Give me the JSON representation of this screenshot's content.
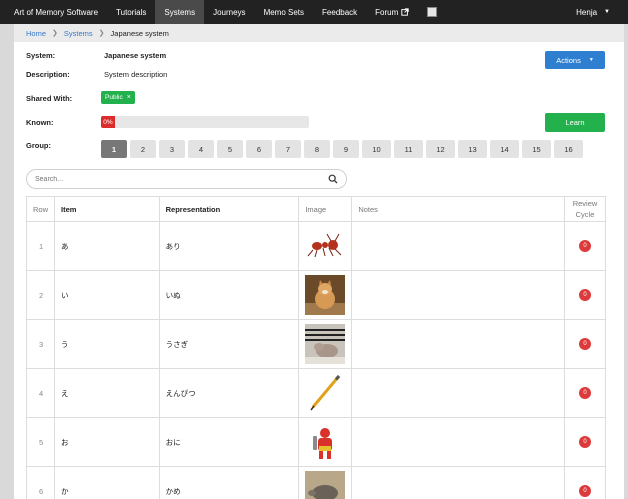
{
  "navbar": {
    "brand": "Art of Memory Software",
    "links": [
      "Tutorials",
      "Systems",
      "Journeys",
      "Memo Sets",
      "Feedback",
      "Forum"
    ],
    "active_index": 1,
    "user": "Henja"
  },
  "breadcrumb": {
    "home": "Home",
    "systems": "Systems",
    "current": "Japanese system"
  },
  "details": {
    "system_label": "System:",
    "system_value": "Japanese system",
    "description_label": "Description:",
    "description_value": "System description",
    "shared_label": "Shared With:",
    "shared_badge": "Public",
    "known_label": "Known:",
    "known_percent": 0,
    "known_text": "0%",
    "group_label": "Group:"
  },
  "buttons": {
    "actions": "Actions",
    "learn": "Learn"
  },
  "groups": [
    "1",
    "2",
    "3",
    "4",
    "5",
    "6",
    "7",
    "8",
    "9",
    "10",
    "11",
    "12",
    "13",
    "14",
    "15",
    "16"
  ],
  "groups_active_index": 0,
  "search": {
    "placeholder": "Search..."
  },
  "table": {
    "headers": {
      "row": "Row",
      "item": "Item",
      "representation": "Representation",
      "image": "Image",
      "notes": "Notes",
      "review": "Review Cycle"
    },
    "rows": [
      {
        "row": "1",
        "item": "あ",
        "representation": "あり",
        "image": "ant",
        "notes": "",
        "review": "0"
      },
      {
        "row": "2",
        "item": "い",
        "representation": "いぬ",
        "image": "dog",
        "notes": "",
        "review": "0"
      },
      {
        "row": "3",
        "item": "う",
        "representation": "うさぎ",
        "image": "rabbit",
        "notes": "",
        "review": "0"
      },
      {
        "row": "4",
        "item": "え",
        "representation": "えんぴつ",
        "image": "pencil",
        "notes": "",
        "review": "0"
      },
      {
        "row": "5",
        "item": "お",
        "representation": "おに",
        "image": "oni",
        "notes": "",
        "review": "0"
      },
      {
        "row": "6",
        "item": "か",
        "representation": "かめ",
        "image": "turtle",
        "notes": "",
        "review": "0"
      }
    ]
  },
  "colors": {
    "navbar": "#222222",
    "primary": "#2e7fcf",
    "success": "#22b14c",
    "danger": "#dd2c2c"
  }
}
